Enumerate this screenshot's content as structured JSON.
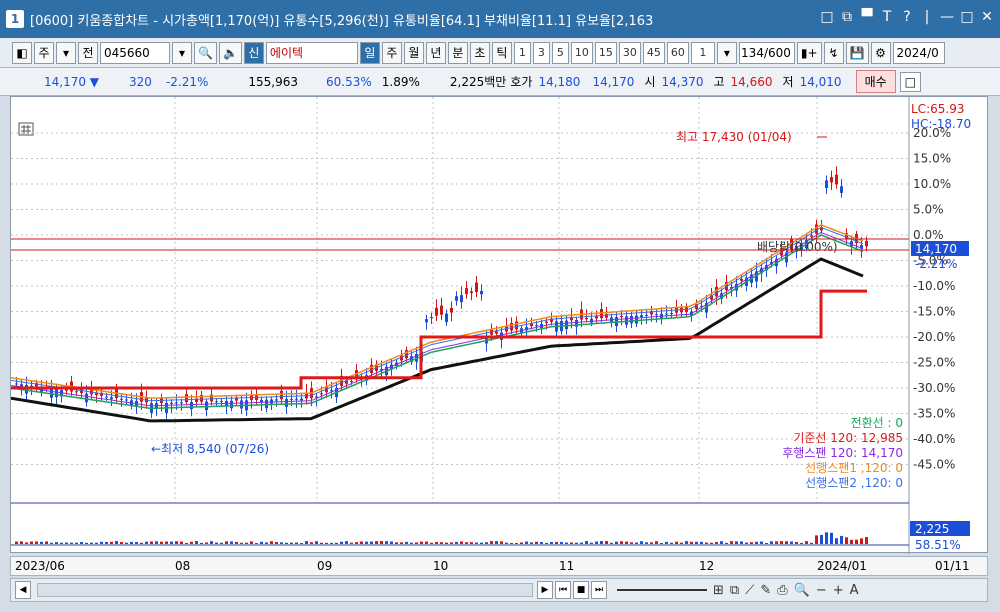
{
  "window": {
    "number": "1",
    "title": "[0600] 키움종합차트 - 시가총액[1,170(억)] 유통수[5,296(천)] 유통비율[64.1] 부채비율[11.1] 유보율[2,163",
    "controls": [
      "□",
      "⧉",
      "▀",
      "T",
      "?",
      "|",
      "—",
      "□",
      "✕"
    ]
  },
  "toolbar": {
    "period_unit": "주",
    "prev_label": "전",
    "stock_code": "045660",
    "new_badge": "신",
    "stock_name": "에이텍",
    "timeframes": [
      "일",
      "주",
      "월",
      "년",
      "분",
      "초",
      "틱"
    ],
    "active_timeframe": "일",
    "intervals": [
      "1",
      "3",
      "5",
      "10",
      "15",
      "30",
      "45",
      "60"
    ],
    "interval_value": "1",
    "bar_count": "134/600",
    "date_value": "2024/0"
  },
  "quote": {
    "price": "14,170 ▼",
    "change": "320",
    "change_pct": "-2.21%",
    "volume": "155,963",
    "vol_ratio": "60.53%",
    "turnover": "1.89%",
    "trade_value": "2,225백만",
    "hoga_label": "호가",
    "ask": "14,180",
    "bid": "14,170",
    "open_label": "시",
    "open": "14,370",
    "high_label": "고",
    "high": "14,660",
    "low_label": "저",
    "low": "14,010",
    "buy_label": "매수",
    "sell_label": "□"
  },
  "chart": {
    "lc_label": "LC:65.93",
    "hc_label": "HC:-18.70",
    "max_annotation": "최고 17,430 (01/04)",
    "min_annotation": "←최저 8,540 (07/26)",
    "dividend_label": "배당락(0.00%)",
    "current_price_tag": "14,170",
    "current_pct_tag": "-2.21%",
    "y_ticks": [
      "20.0%",
      "15.0%",
      "10.0%",
      "5.0%",
      "0.0%",
      "-5.0%",
      "-10.0%",
      "-15.0%",
      "-20.0%",
      "-25.0%",
      "-30.0%",
      "-35.0%",
      "-40.0%",
      "-45.0%"
    ],
    "ichimoku_legend": [
      {
        "text": "전환선 : 0",
        "color": "#1aa35a"
      },
      {
        "text": "기준선 120: 12,985",
        "color": "#e01818"
      },
      {
        "text": "후행스팬 120: 14,170",
        "color": "#8a2be2"
      },
      {
        "text": "선행스팬1 ,120: 0",
        "color": "#f28a1c"
      },
      {
        "text": "선행스팬2 ,120: 0",
        "color": "#3a6ee8"
      }
    ],
    "volume_tag": "2,225",
    "volume_pct_tag": "58.51%"
  },
  "x_axis": {
    "labels": [
      "2023/06",
      "08",
      "09",
      "10",
      "11",
      "12",
      "2024/01",
      "01/11"
    ]
  },
  "scrollbar": {
    "buttons": [
      "◀",
      "▶",
      "⏮",
      "■",
      "⏭"
    ]
  },
  "chart_data": {
    "type": "line",
    "title": "",
    "y_unit": "%",
    "ylim": [
      -48,
      22
    ],
    "x": [
      "2023/06",
      "08",
      "09",
      "10",
      "11",
      "12",
      "2024/01"
    ],
    "series": [
      {
        "values": [
          -29,
          -33,
          -32,
          -22,
          -17,
          -15,
          1,
          -2.2
        ]
      }
    ]
  }
}
